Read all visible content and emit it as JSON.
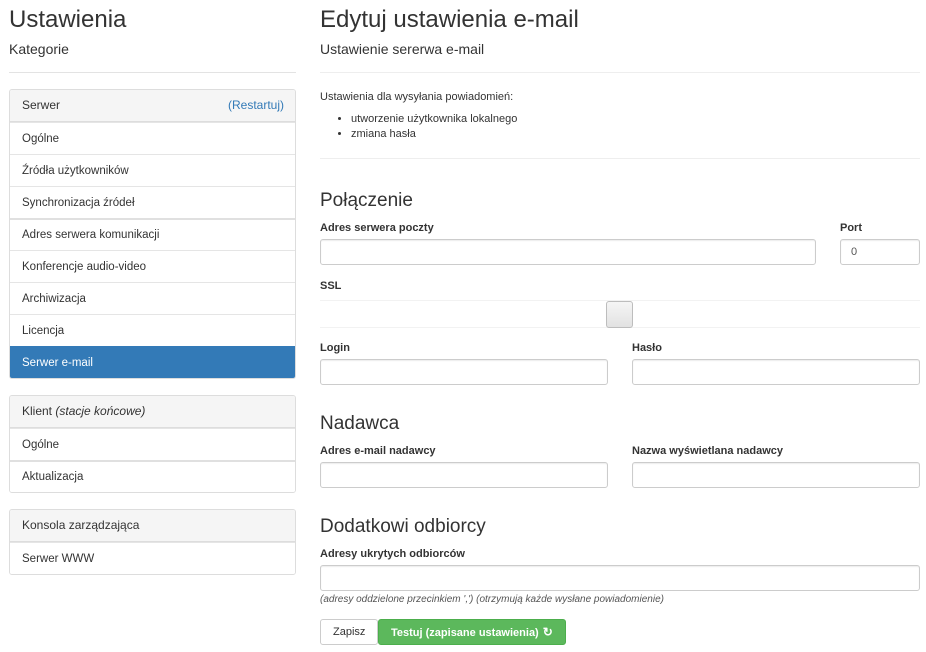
{
  "sidebar": {
    "title": "Ustawienia",
    "subtitle": "Kategorie",
    "server_panel": {
      "heading": "Serwer",
      "restart_link": "(Restartuj)",
      "items": [
        {
          "label": "Ogólne"
        },
        {
          "label": "Źródła użytkowników"
        },
        {
          "label": "Synchronizacja źródeł"
        },
        {
          "label": "Adres serwera komunikacji"
        },
        {
          "label": "Konferencje audio-video"
        },
        {
          "label": "Archiwizacja"
        },
        {
          "label": "Licencja"
        },
        {
          "label": "Serwer e-mail",
          "active": true
        }
      ]
    },
    "client_panel": {
      "heading": "Klient",
      "heading_note": "(stacje końcowe)",
      "items": [
        {
          "label": "Ogólne"
        },
        {
          "label": "Aktualizacja"
        }
      ]
    },
    "console_panel": {
      "heading": "Konsola zarządzająca",
      "items": [
        {
          "label": "Serwer WWW"
        }
      ]
    }
  },
  "main": {
    "title": "Edytuj ustawienia e-mail",
    "subtitle": "Ustawienie sererwa e-mail",
    "intro": "Ustawienia dla wysyłania powiadomień:",
    "notifications": [
      "utworzenie użytkownika lokalnego",
      "zmiana hasła"
    ],
    "connection": {
      "title": "Połączenie",
      "server_label": "Adres serwera poczty",
      "server_value": "",
      "port_label": "Port",
      "port_value": "0",
      "ssl_label": "SSL",
      "login_label": "Login",
      "login_value": "",
      "password_label": "Hasło",
      "password_value": ""
    },
    "sender": {
      "title": "Nadawca",
      "email_label": "Adres e-mail nadawcy",
      "email_value": "",
      "name_label": "Nazwa wyświetlana nadawcy",
      "name_value": ""
    },
    "extra": {
      "title": "Dodatkowi odbiorcy",
      "bcc_label": "Adresy ukrytych odbiorców",
      "bcc_value": "",
      "bcc_hint": "(adresy oddzielone przecinkiem ',') (otrzymują każde wysłane powiadomienie)"
    },
    "buttons": {
      "save": "Zapisz",
      "test": "Testuj (zapisane ustawienia)"
    }
  },
  "colors": {
    "primary": "#337ab7",
    "success": "#5cb85c"
  },
  "icons": {
    "test_button": "refresh-icon"
  }
}
